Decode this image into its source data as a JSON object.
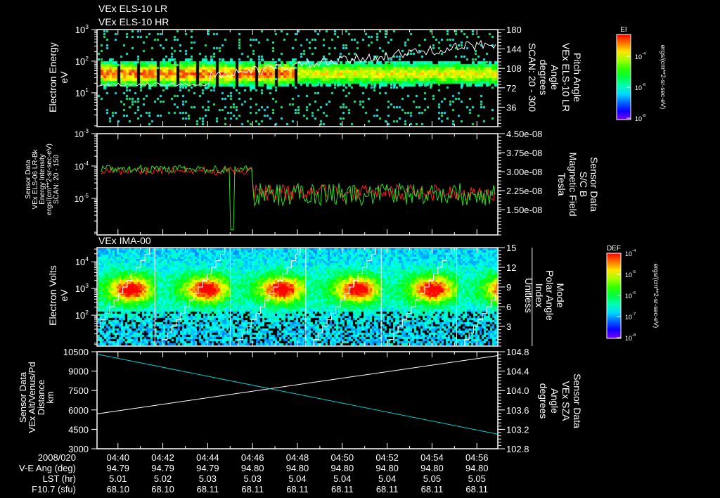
{
  "titles": {
    "top1": "VEx ELS-10 LR",
    "top2": "VEx ELS-10 HR",
    "panel3": "VEx IMA-00"
  },
  "colors": {
    "background": "#000000",
    "axis": "#ffffff",
    "red": "#ff2020",
    "green": "#20e020",
    "cyan": "#00d0d0"
  },
  "time_axis": {
    "date": "2008/020",
    "ticks": [
      "04:40",
      "04:42",
      "04:44",
      "04:46",
      "04:48",
      "04:50",
      "04:52",
      "04:54",
      "04:56"
    ],
    "rows": [
      {
        "label": "V-E Ang (deg)",
        "values": [
          "94.79",
          "94.79",
          "94.79",
          "94.80",
          "94.80",
          "94.80",
          "94.80",
          "94.80",
          "94.80"
        ]
      },
      {
        "label": "LST (hr)",
        "values": [
          "5.01",
          "5.02",
          "5.03",
          "5.03",
          "5.04",
          "5.04",
          "5.04",
          "5.05",
          "5.05"
        ]
      },
      {
        "label": "F10.7 (sfu)",
        "values": [
          "68.10",
          "68.10",
          "68.11",
          "68.11",
          "68.11",
          "68.11",
          "68.11",
          "68.11",
          "68.11"
        ]
      }
    ]
  },
  "chart_data": [
    {
      "type": "heatmap",
      "title": "VEx ELS-10 LR / VEx ELS-10 HR",
      "ylabel": [
        "Electron Energy",
        "eV"
      ],
      "yscale": "log",
      "ylim": [
        0.85,
        1000
      ],
      "yticks": [
        "10^1",
        "10^2",
        "10^3"
      ],
      "y2label": [
        "Pitch Angle",
        "VEx ELS-10 LR",
        "Angle",
        "degrees",
        "SCAN: 20 - 300"
      ],
      "y2lim": [
        0,
        180
      ],
      "y2ticks": [
        "36",
        "72",
        "108",
        "144",
        "180"
      ],
      "overlay_line": {
        "color": "#ffffff",
        "axis": "right",
        "start_value": 78,
        "end_value": 155
      },
      "colorbar": {
        "title": "EI",
        "ticks": [
          "10^-4",
          "10^-6",
          "10^-8"
        ],
        "units": "ergs/(cm**2-sr-sec-eV)",
        "colormap": "rainbow"
      }
    },
    {
      "type": "line",
      "ylabel": [
        "Sensor Data",
        "VEx ELS-06 LR-Bk",
        "Energy Intensity",
        "ergs/(cm**2-sr-sec-eV)",
        "SCAN: 20 - 150"
      ],
      "yscale": "log",
      "ylim": [
        7.4e-07,
        0.001
      ],
      "yticks": [
        "10^-5",
        "10^-4",
        "10^-3"
      ],
      "y2label": [
        "Sensor Data",
        "S/C B",
        "Magnetic Field",
        "Tesla"
      ],
      "y2lim": [
        5e-09,
        4.5e-08
      ],
      "y2ticks": [
        "1.50e-08",
        "2.25e-08",
        "3.00e-08",
        "3.75e-08",
        "4.50e-08"
      ],
      "series": [
        {
          "color": "#ff2020",
          "axis": "left",
          "approx_before_0446": 7e-05,
          "approx_after_0446": 1.5e-05
        },
        {
          "color": "#20e020",
          "axis": "right",
          "approx_before_0446": 3.1e-08,
          "approx_after_0446": 2.1e-08
        }
      ]
    },
    {
      "type": "heatmap",
      "title": "VEx IMA-00",
      "ylabel": [
        "Electron Volts",
        "eV"
      ],
      "yscale": "log",
      "ylim": [
        7,
        34000
      ],
      "yticks": [
        "10^2",
        "10^3",
        "10^4"
      ],
      "y2label": [
        "Mode",
        "Polar Angle",
        "Index",
        "Unitless"
      ],
      "y2lim": [
        0,
        15
      ],
      "y2ticks": [
        "3",
        "6",
        "9",
        "12",
        "15"
      ],
      "overlay_line": {
        "color": "#ffffff",
        "axis": "right",
        "shape": "staircase 0-15 per scan"
      },
      "colorbar": {
        "title": "DEF",
        "ticks": [
          "10^-4",
          "10^-5",
          "10^-6",
          "10^-7",
          "10^-8"
        ],
        "units": "ergs/(cm**2-sr-sec-eV)",
        "colormap": "rainbow"
      }
    },
    {
      "type": "line",
      "ylabel": [
        "Sensor Data",
        "VEx Alt/Venus/Pd",
        "Distance",
        "km"
      ],
      "ylim": [
        3000,
        10500
      ],
      "yticks": [
        "3000",
        "4500",
        "6000",
        "7500",
        "9000",
        "10500"
      ],
      "y2label": [
        "Sensor Data",
        "VEx SZA",
        "Angle",
        "degrees"
      ],
      "y2lim": [
        102.8,
        104.8
      ],
      "y2ticks": [
        "102.8",
        "103.2",
        "103.6",
        "104.0",
        "104.4",
        "104.8"
      ],
      "x": [
        "04:39:04",
        "04:56:56"
      ],
      "series": [
        {
          "color": "#ffffff",
          "axis": "left",
          "values": [
            5700,
            10200
          ]
        },
        {
          "color": "#00d0d0",
          "axis": "right",
          "values": [
            104.75,
            103.1
          ]
        }
      ]
    }
  ]
}
